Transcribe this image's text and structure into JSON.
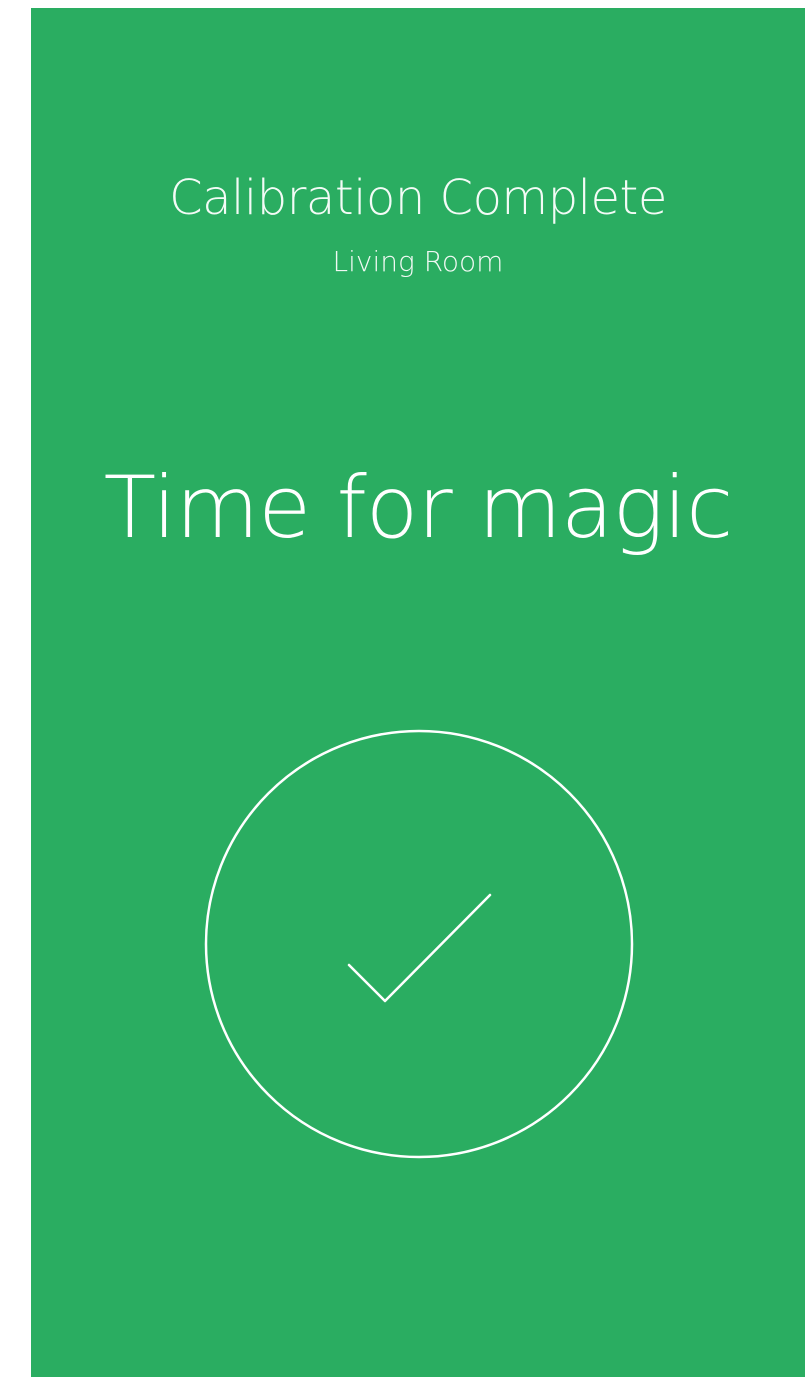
{
  "screen": {
    "title": "Calibration Complete",
    "subtitle": "Living Room",
    "headline": "Time for magic",
    "status_icon": "check-circle-icon",
    "background_color": "#2aad61",
    "foreground_color": "#ffffff"
  }
}
